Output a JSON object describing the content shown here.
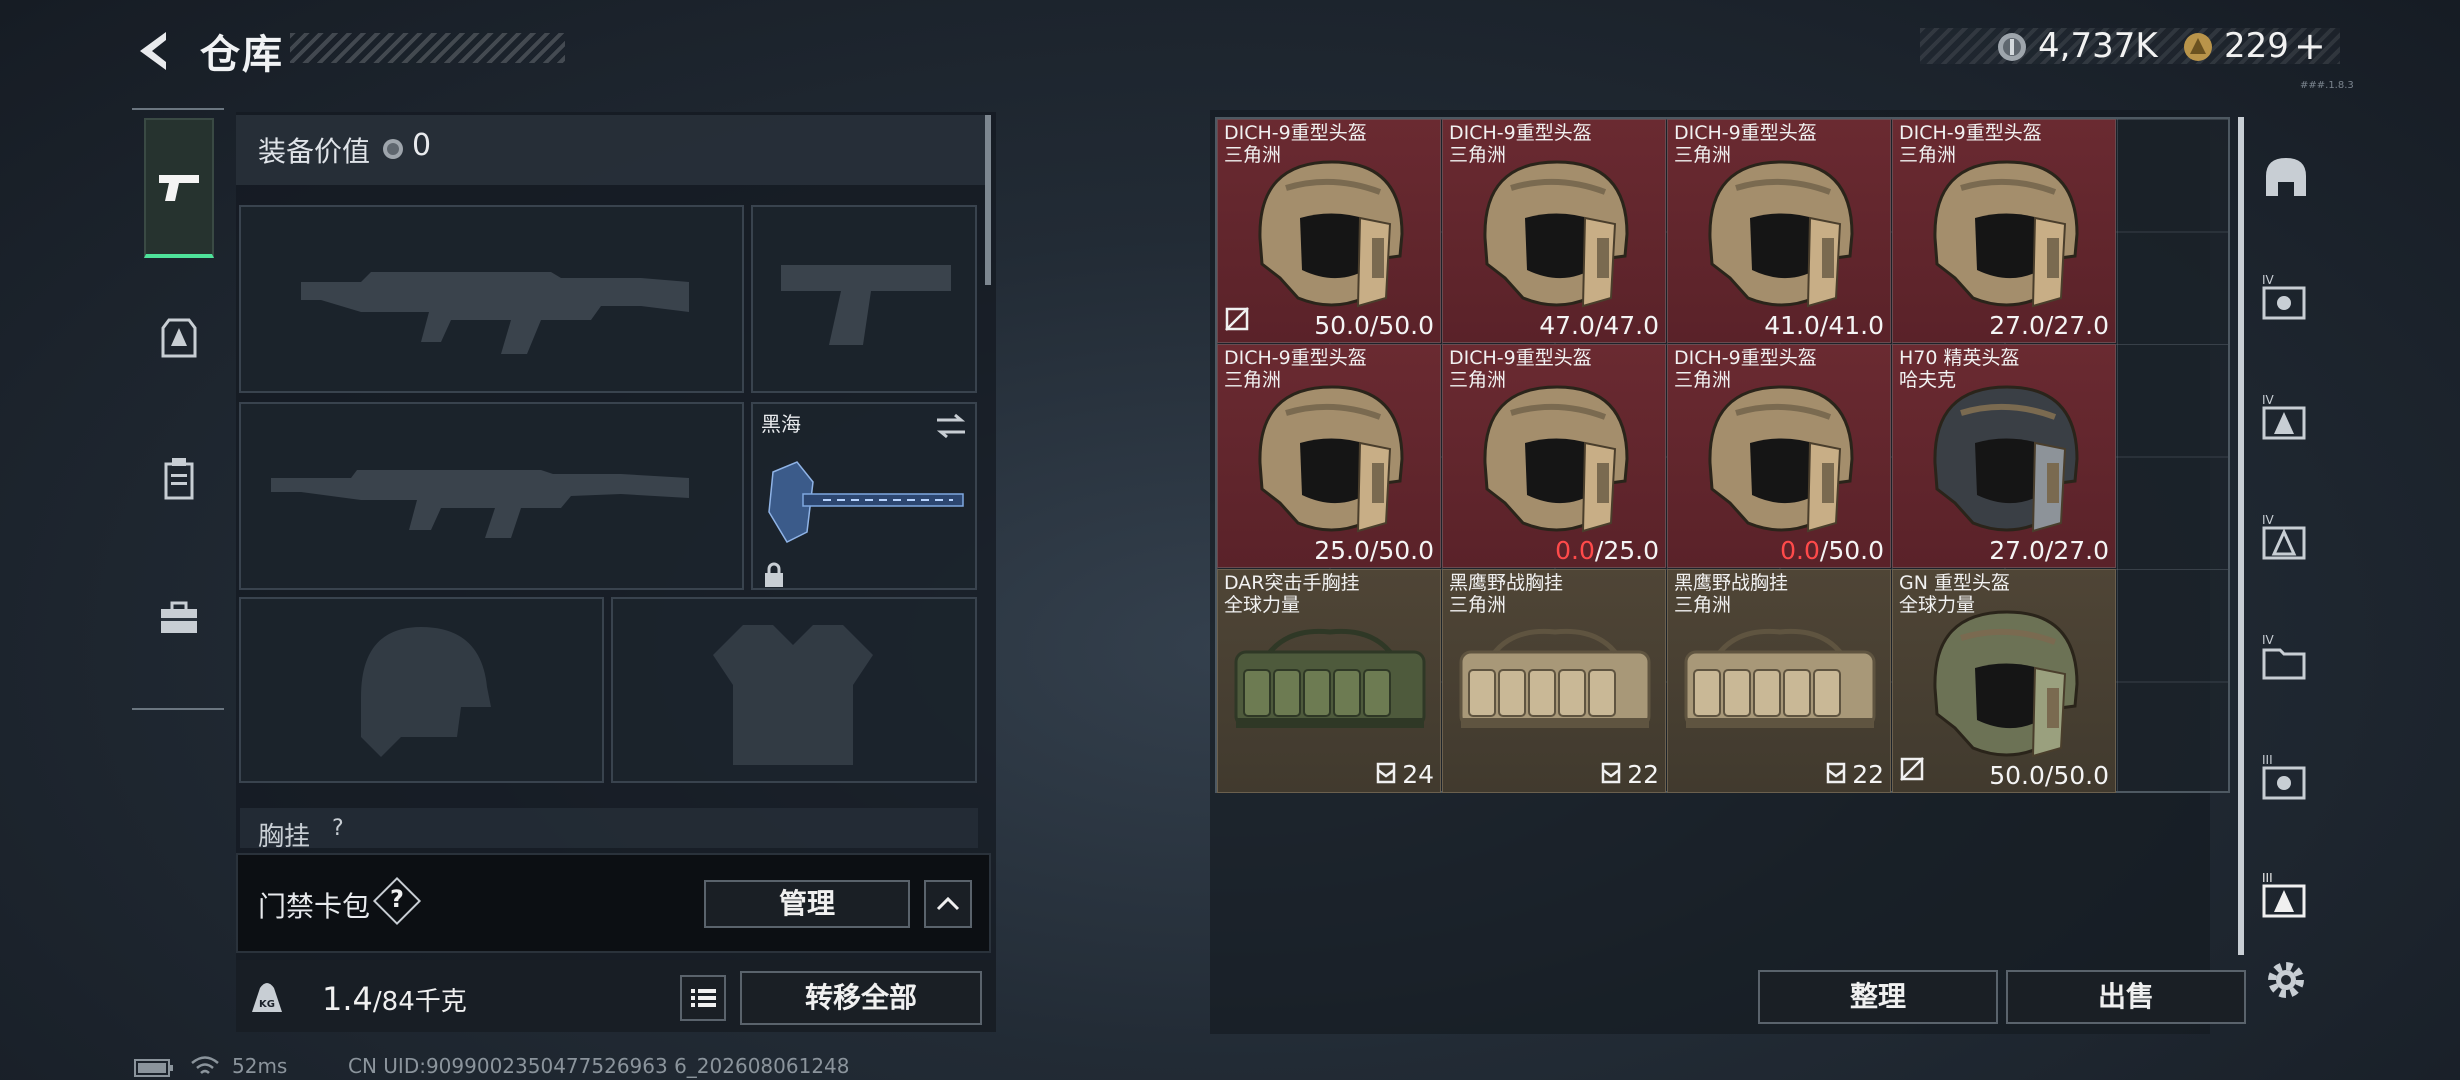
{
  "header": {
    "title": "仓库",
    "currency_silver": "4,737K",
    "currency_gold": "229",
    "gold_plus": "+",
    "version": "###.1.8.3"
  },
  "left": {
    "tabs": [
      "pistol-icon",
      "armor-icon",
      "backpack-icon",
      "toolbox-icon"
    ],
    "equip_value_label": "装备价值",
    "equip_value": "0",
    "melee_name": "黑海",
    "chest_label": "胸挂",
    "chest_help": "?",
    "card_bag_label": "门禁卡包",
    "card_bag_help": "?",
    "manage_label": "管理",
    "weight_current": "1.4",
    "weight_max": "/84千克",
    "transfer_all_label": "转移全部"
  },
  "stash": {
    "items": [
      {
        "name": "DICH-9重型头盔",
        "sub": "三角洲",
        "v1": "50.0",
        "v2": "/50.0",
        "v1_red": false,
        "type": "helmet-tan",
        "no_repair": true
      },
      {
        "name": "DICH-9重型头盔",
        "sub": "三角洲",
        "v1": "47.0",
        "v2": "/47.0",
        "v1_red": false,
        "type": "helmet-tan",
        "no_repair": false
      },
      {
        "name": "DICH-9重型头盔",
        "sub": "三角洲",
        "v1": "41.0",
        "v2": "/41.0",
        "v1_red": false,
        "type": "helmet-tan",
        "no_repair": false
      },
      {
        "name": "DICH-9重型头盔",
        "sub": "三角洲",
        "v1": "27.0",
        "v2": "/27.0",
        "v1_red": false,
        "type": "helmet-tan",
        "no_repair": false
      },
      {
        "name": "DICH-9重型头盔",
        "sub": "三角洲",
        "v1": "25.0",
        "v2": "/50.0",
        "v1_red": false,
        "type": "helmet-tan",
        "no_repair": false
      },
      {
        "name": "DICH-9重型头盔",
        "sub": "三角洲",
        "v1": "0.0",
        "v2": "/25.0",
        "v1_red": true,
        "type": "helmet-tan",
        "no_repair": false
      },
      {
        "name": "DICH-9重型头盔",
        "sub": "三角洲",
        "v1": "0.0",
        "v2": "/50.0",
        "v1_red": true,
        "type": "helmet-tan",
        "no_repair": false
      },
      {
        "name": "H70 精英头盔",
        "sub": "哈夫克",
        "v1": "27.0",
        "v2": "/27.0",
        "v1_red": false,
        "type": "helmet-black",
        "no_repair": false
      },
      {
        "name": "DAR突击手胸挂",
        "sub": "全球力量",
        "v1": "24",
        "v2": "",
        "v1_red": false,
        "type": "rig-green",
        "no_repair": false
      },
      {
        "name": "黑鹰野战胸挂",
        "sub": "三角洲",
        "v1": "22",
        "v2": "",
        "v1_red": false,
        "type": "rig-tan",
        "no_repair": false
      },
      {
        "name": "黑鹰野战胸挂",
        "sub": "三角洲",
        "v1": "22",
        "v2": "",
        "v1_red": false,
        "type": "rig-tan",
        "no_repair": false
      },
      {
        "name": "GN 重型头盔",
        "sub": "全球力量",
        "v1": "50.0",
        "v2": "/50.0",
        "v1_red": false,
        "type": "helmet-green",
        "no_repair": true
      }
    ],
    "sort_label": "整理",
    "sell_label": "出售"
  },
  "side_icons": [
    "helmet-slot-icon",
    "level4-gear-icon",
    "level4-armor-icon",
    "level4-armor-alt-icon",
    "level4-folder-icon",
    "level3-gear-icon",
    "level3-armor-icon",
    "settings-icon"
  ],
  "status": {
    "ping": "52ms",
    "uid": "CN UID:9099002350477526963 6_202608061248"
  }
}
